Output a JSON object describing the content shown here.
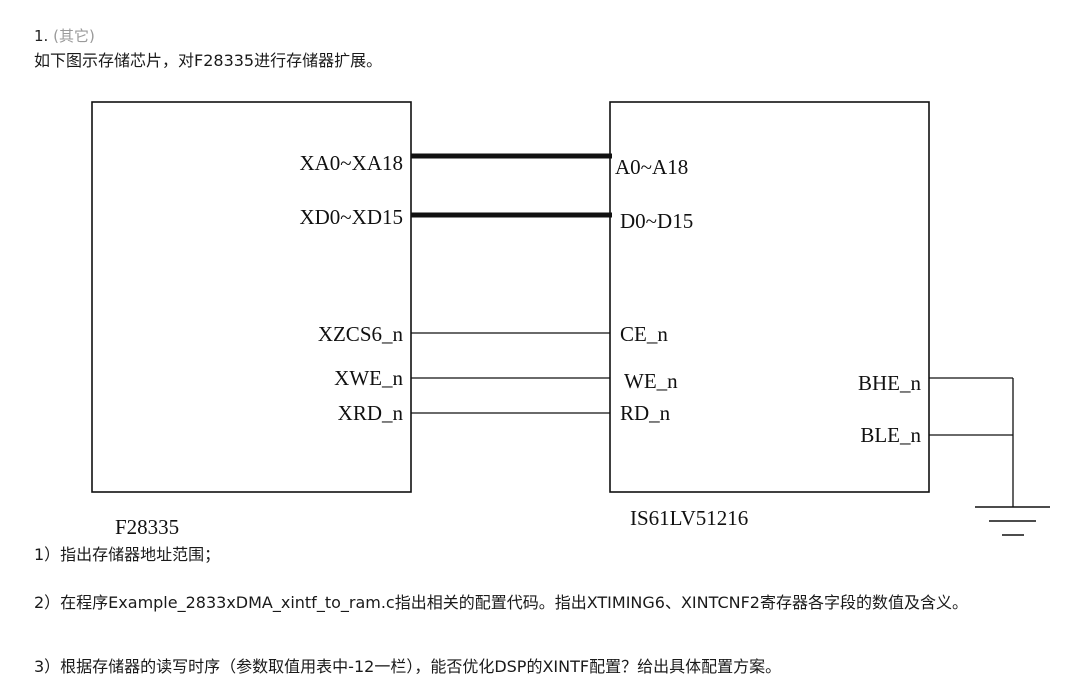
{
  "header": {
    "number": "1.",
    "type": "(其它)",
    "description": "如下图示存储芯片，对F28335进行存储器扩展。"
  },
  "diagram": {
    "left_chip": {
      "name": "F28335",
      "pins": [
        "XA0~XA18",
        "XD0~XD15",
        "XZCS6_n",
        "XWE_n",
        "XRD_n"
      ]
    },
    "right_chip": {
      "name": "IS61LV51216",
      "pins": [
        "A0~A18",
        "D0~D15",
        "CE_n",
        "WE_n",
        "RD_n"
      ],
      "side_pins": [
        "BHE_n",
        "BLE_n"
      ]
    },
    "colors": {
      "line": "#111111",
      "background": "#ffffff"
    }
  },
  "questions": [
    "1）指出存储器地址范围；",
    "2）在程序Example_2833xDMA_xintf_to_ram.c指出相关的配置代码。指出XTIMING6、XINTCNF2寄存器各字段的数值及含义。",
    "3）根据存储器的读写时序（参数取值用表中-12一栏），能否优化DSP的XINTF配置？给出具体配置方案。"
  ]
}
